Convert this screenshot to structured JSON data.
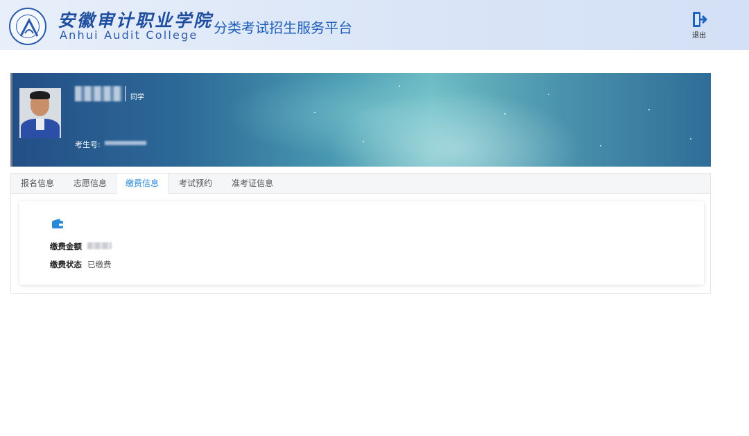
{
  "header": {
    "school_name_cn": "安徽审计职业学院",
    "school_name_en": "Anhui Audit College",
    "platform_title": "分类考试招生服务平台",
    "logout_label": "退出"
  },
  "banner": {
    "name_suffix": "同学",
    "exam_number_label": "考生号:"
  },
  "tabs": [
    {
      "label": "报名信息",
      "active": false
    },
    {
      "label": "志愿信息",
      "active": false
    },
    {
      "label": "缴费信息",
      "active": true
    },
    {
      "label": "考试预约",
      "active": false
    },
    {
      "label": "准考证信息",
      "active": false
    }
  ],
  "payment": {
    "amount_label": "缴费金额",
    "status_label": "缴费状态",
    "status_value": "已缴费"
  },
  "colors": {
    "brand_blue": "#1f5fb8",
    "tab_active": "#2a8ad8",
    "wallet_icon": "#2a8ad8"
  },
  "icons": {
    "logo": "college-seal-icon",
    "logout": "logout-icon",
    "wallet": "wallet-icon"
  }
}
